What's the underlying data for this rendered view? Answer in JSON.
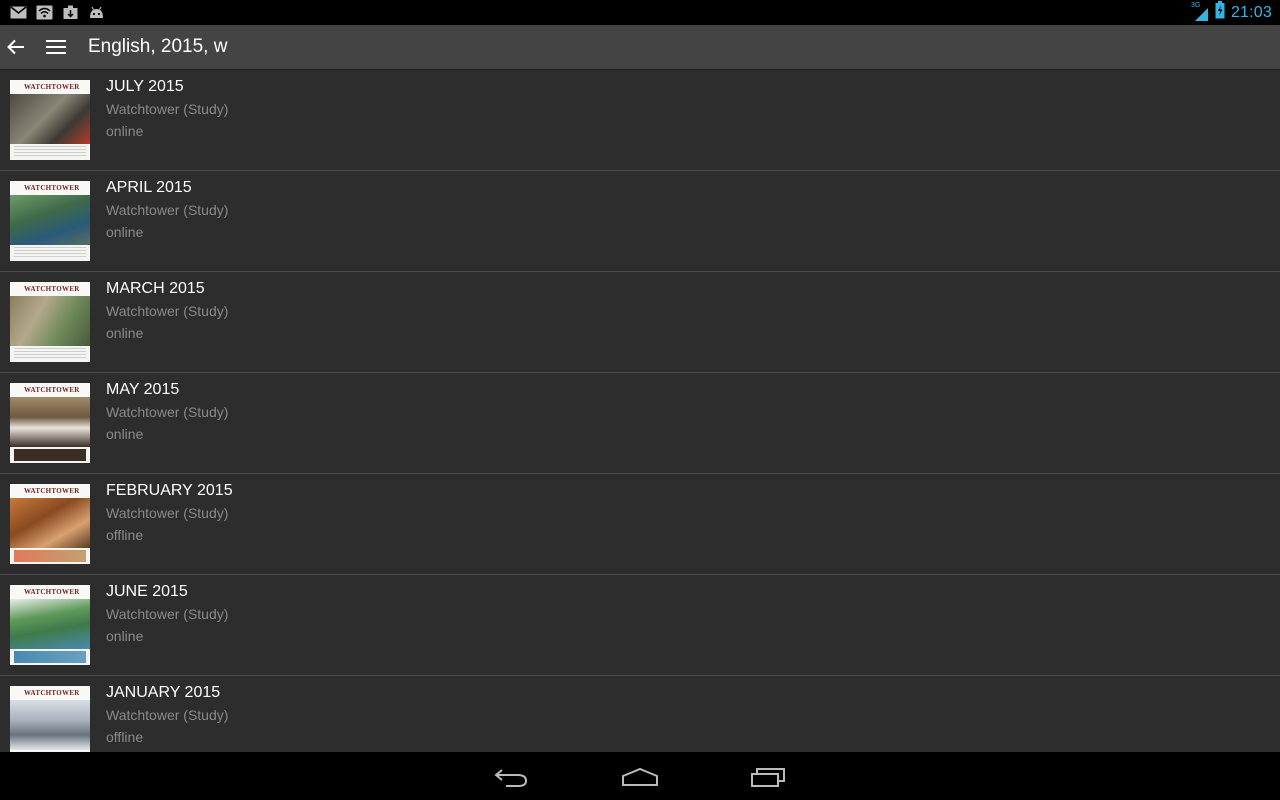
{
  "status_bar": {
    "time": "21:03",
    "network": "3G",
    "left_icons": [
      "gmail-icon",
      "wifi-icon",
      "download-icon",
      "android-icon"
    ]
  },
  "action_bar": {
    "title": "English, 2015, w"
  },
  "items": [
    {
      "title": "JULY 2015",
      "subtitle": "Watchtower (Study)",
      "status": "online",
      "cover_color": "#6f6a5c"
    },
    {
      "title": "APRIL 2015",
      "subtitle": "Watchtower (Study)",
      "status": "online",
      "cover_color": "#4f7a5b"
    },
    {
      "title": "MARCH 2015",
      "subtitle": "Watchtower (Study)",
      "status": "online",
      "cover_color": "#7f8b6a"
    },
    {
      "title": "MAY 2015",
      "subtitle": "Watchtower (Study)",
      "status": "online",
      "cover_color": "#8a6f52"
    },
    {
      "title": "FEBRUARY 2015",
      "subtitle": "Watchtower (Study)",
      "status": "offline",
      "cover_color": "#a0642e"
    },
    {
      "title": "JUNE 2015",
      "subtitle": "Watchtower (Study)",
      "status": "online",
      "cover_color": "#4f8a5a"
    },
    {
      "title": "JANUARY 2015",
      "subtitle": "Watchtower (Study)",
      "status": "offline",
      "cover_color": "#a9b3bd"
    }
  ],
  "cover_masthead": "WATCHTOWER",
  "colors": {
    "accent": "#33b5e5",
    "background": "#2d2d2d",
    "action_bar": "#444444"
  }
}
